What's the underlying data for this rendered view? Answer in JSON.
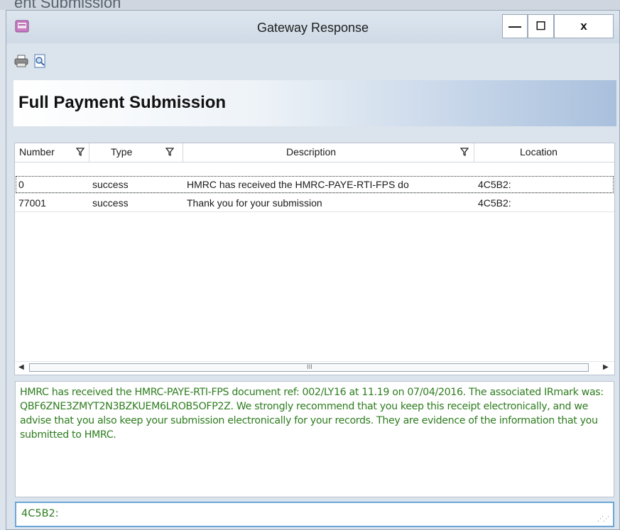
{
  "background_text": "ent Submission",
  "window": {
    "title": "Gateway Response",
    "buttons": {
      "minimize": "—",
      "maximize": "☐",
      "close": "x"
    }
  },
  "toolbar": {
    "icons": [
      "printer-icon",
      "print-preview-icon"
    ]
  },
  "header": {
    "title": "Full Payment Submission"
  },
  "grid": {
    "columns": [
      "Number",
      "Type",
      "Description",
      "Location"
    ],
    "rows": [
      {
        "number": "0",
        "type": "success",
        "description": "HMRC has received the HMRC-PAYE-RTI-FPS do",
        "location": "4C5B2:"
      },
      {
        "number": "77001",
        "type": "success",
        "description": "Thank you for your submission",
        "location": "4C5B2:"
      }
    ],
    "selected_row": 0,
    "scrollbar_grip": "III"
  },
  "detail_text": "HMRC has received the HMRC-PAYE-RTI-FPS document ref: 002/LY16 at 11.19 on 07/04/2016. The associated IRmark was: QBF6ZNE3ZMYT2N3BZKUEM6LROB5OFP2Z. We strongly recommend that you keep this receipt electronically, and we advise that you also keep your submission electronically for your records. They are evidence of the information that you submitted to HMRC.",
  "location_text": "4C5B2:",
  "colors": {
    "detail_text": "#2e7d1f",
    "header_gradient_end": "#a9c0dd",
    "focus_border": "#6aa7d8"
  }
}
